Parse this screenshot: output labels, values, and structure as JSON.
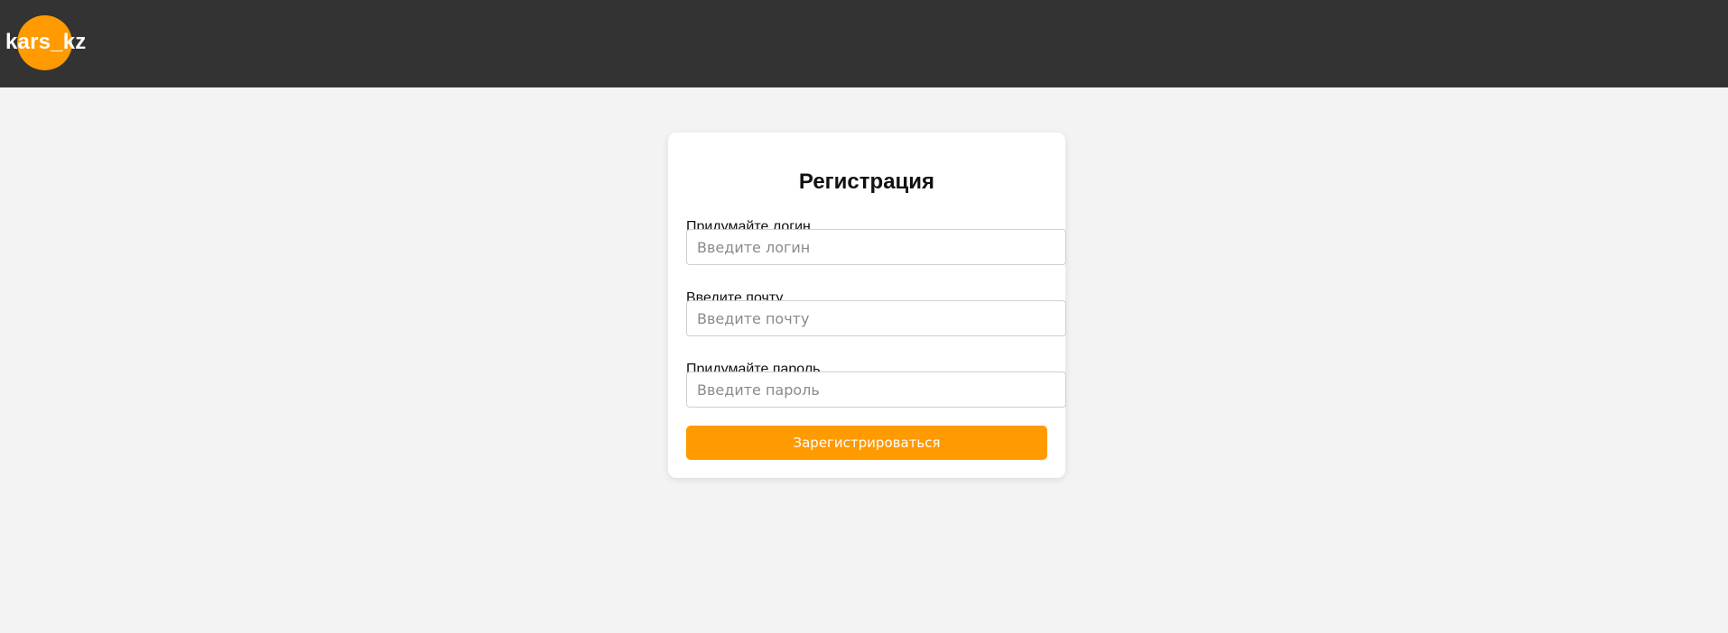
{
  "header": {
    "logo_text": "kars_kz"
  },
  "form": {
    "title": "Регистрация",
    "fields": [
      {
        "label": "Придумайте логин",
        "placeholder": "Введите логин",
        "value": ""
      },
      {
        "label": "Введите почту",
        "placeholder": "Введите почту",
        "value": ""
      },
      {
        "label": "Придумайте пароль",
        "placeholder": "Введите пароль",
        "value": ""
      }
    ],
    "submit_label": "Зарегистрироваться"
  },
  "colors": {
    "header_bg": "#333333",
    "accent": "#ff9a00",
    "page_bg": "#f3f3f3",
    "card_bg": "#ffffff"
  }
}
